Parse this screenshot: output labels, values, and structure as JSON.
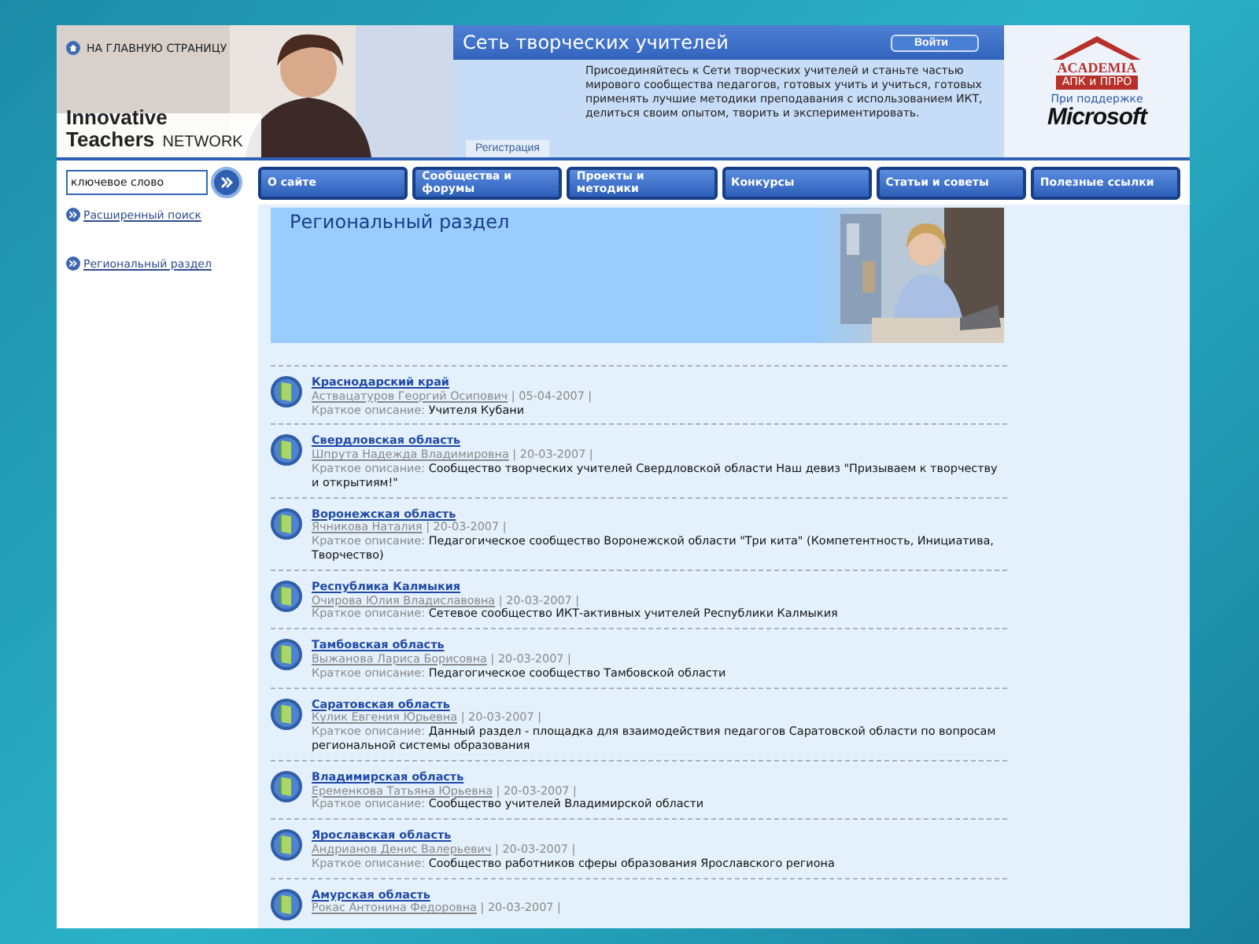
{
  "header": {
    "home_link": "НА ГЛАВНУЮ СТРАНИЦУ",
    "logo_line1": "Innovative",
    "logo_bold": "Teachers",
    "logo_light": "NETWORK",
    "title": "Сеть творческих учителей",
    "login_button": "Войти",
    "intro": "Присоединяйтесь к Сети творческих учителей и станьте частью мирового сообщества педагогов, готовых учить и учиться, готовых применять лучшие методики преподавания с использованием ИКТ, делиться своим опытом, творить и экспериментировать.",
    "register_tab": "Регистрация",
    "academia_name": "ACADEMIA",
    "academia_sub": "АПК и ППРО",
    "support_label": "При поддержке",
    "sponsor": "Microsoft"
  },
  "search": {
    "placeholder": "ключевое слово"
  },
  "nav": [
    {
      "label": "О сайте"
    },
    {
      "label": "Сообщества и форумы"
    },
    {
      "label": "Проекты и методики"
    },
    {
      "label": "Конкурсы"
    },
    {
      "label": "Статьи и советы"
    },
    {
      "label": "Полезные ссылки"
    }
  ],
  "sidebar": {
    "items": [
      {
        "label": "Расширенный поиск"
      },
      {
        "label": "Региональный раздел"
      }
    ]
  },
  "banner": {
    "title": "Региональный раздел"
  },
  "entries": [
    {
      "title": "Краснодарский край",
      "author": "Аствацатуров Георгий Осипович",
      "date": "| 05-04-2007 |",
      "desc_label": "Краткое описание:",
      "description": "Учителя Кубани"
    },
    {
      "title": "Свердловская область",
      "author": "Шпрута Надежда Владимировна",
      "date": "| 20-03-2007 |",
      "desc_label": "Краткое описание:",
      "description": "Сообщество творческих учителей Свердловской области Наш девиз \"Призываем к творчеству и открытиям!\""
    },
    {
      "title": "Воронежская область",
      "author": "Ячникова Наталия",
      "date": "| 20-03-2007 |",
      "desc_label": "Краткое описание:",
      "description": "Педагогическое сообщество Воронежской области \"Три кита\" (Компетентность, Инициатива, Творчество)"
    },
    {
      "title": "Республика Калмыкия",
      "author": "Очирова Юлия Владиславовна",
      "date": "| 20-03-2007 |",
      "desc_label": "Краткое описание:",
      "description": "Сетевое сообщество ИКТ-активных учителей Республики Калмыкия"
    },
    {
      "title": "Тамбовская область",
      "author": "Выжанова Лариса Борисовна",
      "date": "| 20-03-2007 |",
      "desc_label": "Краткое описание:",
      "description": "Педагогическое сообщество Тамбовской области"
    },
    {
      "title": "Саратовская область",
      "author": "Кулик Евгения Юрьевна",
      "date": "| 20-03-2007 |",
      "desc_label": "Краткое описание:",
      "description": "Данный раздел - площадка для взаимодействия педагогов Саратовской области по вопросам региональной системы образования"
    },
    {
      "title": "Владимирская область",
      "author": "Еременкова Татьяна Юрьевна",
      "date": "| 20-03-2007 |",
      "desc_label": "Краткое описание:",
      "description": "Сообщество учителей Владимирской области"
    },
    {
      "title": "Ярославская область",
      "author": "Андрианов Денис Валерьевич",
      "date": "| 20-03-2007 |",
      "desc_label": "Краткое описание:",
      "description": "Сообщество работников сферы образования Ярославского региона"
    },
    {
      "title": "Амурская область",
      "author": "Рокас Антонина Федоровна",
      "date": "| 20-03-2007 |"
    }
  ]
}
